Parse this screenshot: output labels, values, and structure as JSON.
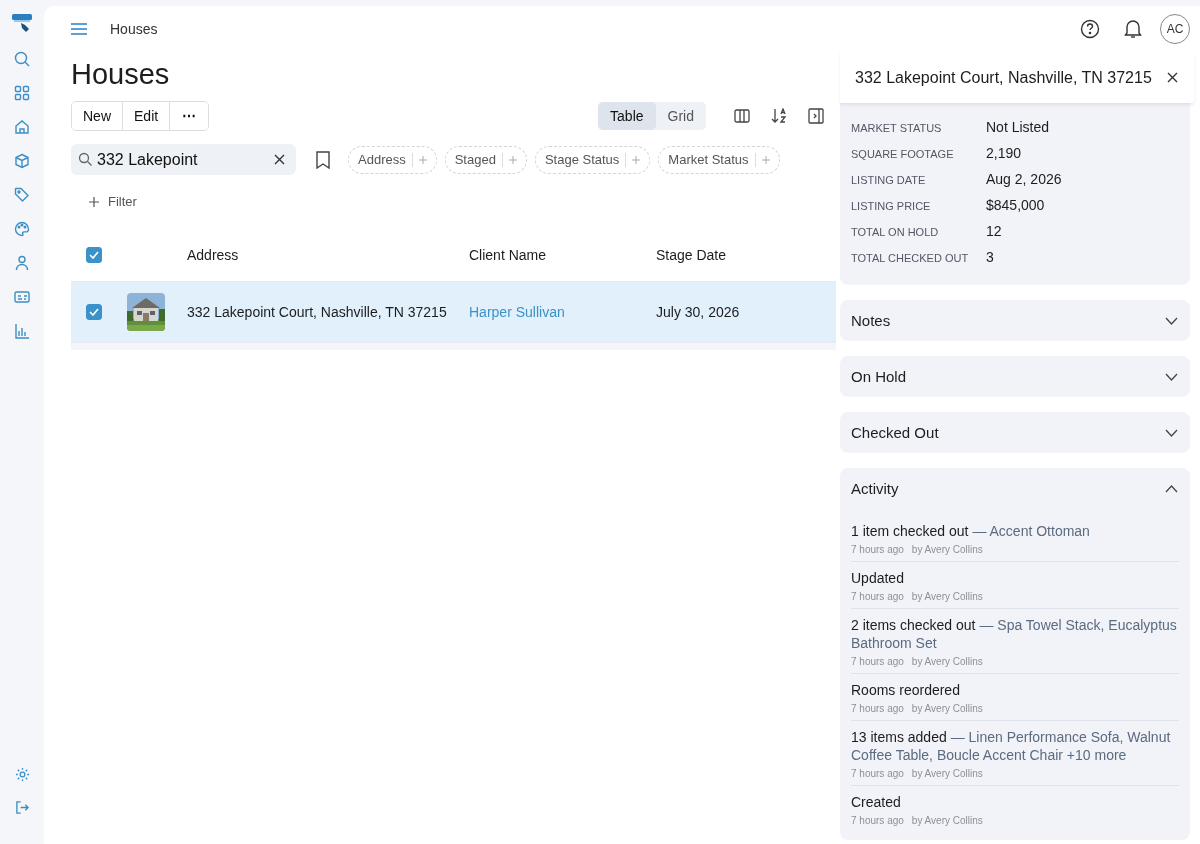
{
  "breadcrumb": "Houses",
  "title": "Houses",
  "avatar": "AC",
  "actions": [
    "New",
    "Edit",
    "⋯"
  ],
  "view_tabs": [
    {
      "label": "Table",
      "selected": true
    },
    {
      "label": "Grid",
      "selected": false
    }
  ],
  "search": {
    "value": "332 Lakepoint"
  },
  "filter_chips": [
    "Address",
    "Staged",
    "Stage Status",
    "Market Status"
  ],
  "filter_button": "Filter",
  "table": {
    "select_all_checked": true,
    "columns": [
      "Address",
      "Client Name",
      "Stage Date"
    ],
    "rows": [
      {
        "selected": true,
        "checked": true,
        "address": "332 Lakepoint Court, Nashville, TN 37215",
        "client": "Harper Sullivan",
        "stage_date": "July 30, 2026"
      }
    ]
  },
  "panel": {
    "title": "332 Lakepoint Court, Nashville, TN 37215",
    "details": [
      {
        "label": "MARKET STATUS",
        "value": "Not Listed"
      },
      {
        "label": "SQUARE FOOTAGE",
        "value": "2,190"
      },
      {
        "label": "LISTING DATE",
        "value": "Aug 2, 2026"
      },
      {
        "label": "LISTING PRICE",
        "value": "$845,000"
      },
      {
        "label": "TOTAL ON HOLD",
        "value": "12"
      },
      {
        "label": "TOTAL CHECKED OUT",
        "value": "3"
      }
    ],
    "sections": [
      {
        "title": "Notes",
        "expanded": false
      },
      {
        "title": "On Hold",
        "expanded": false
      },
      {
        "title": "Checked Out",
        "expanded": false
      },
      {
        "title": "Activity",
        "expanded": true
      }
    ],
    "activity": [
      {
        "text": "1 item checked out",
        "detail": "— Accent Ottoman",
        "time": "7 hours ago",
        "by": "by Avery Collins"
      },
      {
        "text": "Updated",
        "time": "7 hours ago",
        "by": "by Avery Collins"
      },
      {
        "text": "2 items checked out",
        "detail": "— Spa Towel Stack, Eucalyptus Bathroom Set",
        "time": "7 hours ago",
        "by": "by Avery Collins"
      },
      {
        "text": "Rooms reordered",
        "time": "7 hours ago",
        "by": "by Avery Collins"
      },
      {
        "text": "13 items added",
        "detail": "— Linen Performance Sofa, Walnut Coffee Table, Boucle Accent Chair +10 more",
        "time": "7 hours ago",
        "by": "by Avery Collins"
      },
      {
        "text": "Created",
        "time": "7 hours ago",
        "by": "by Avery Collins"
      }
    ]
  }
}
